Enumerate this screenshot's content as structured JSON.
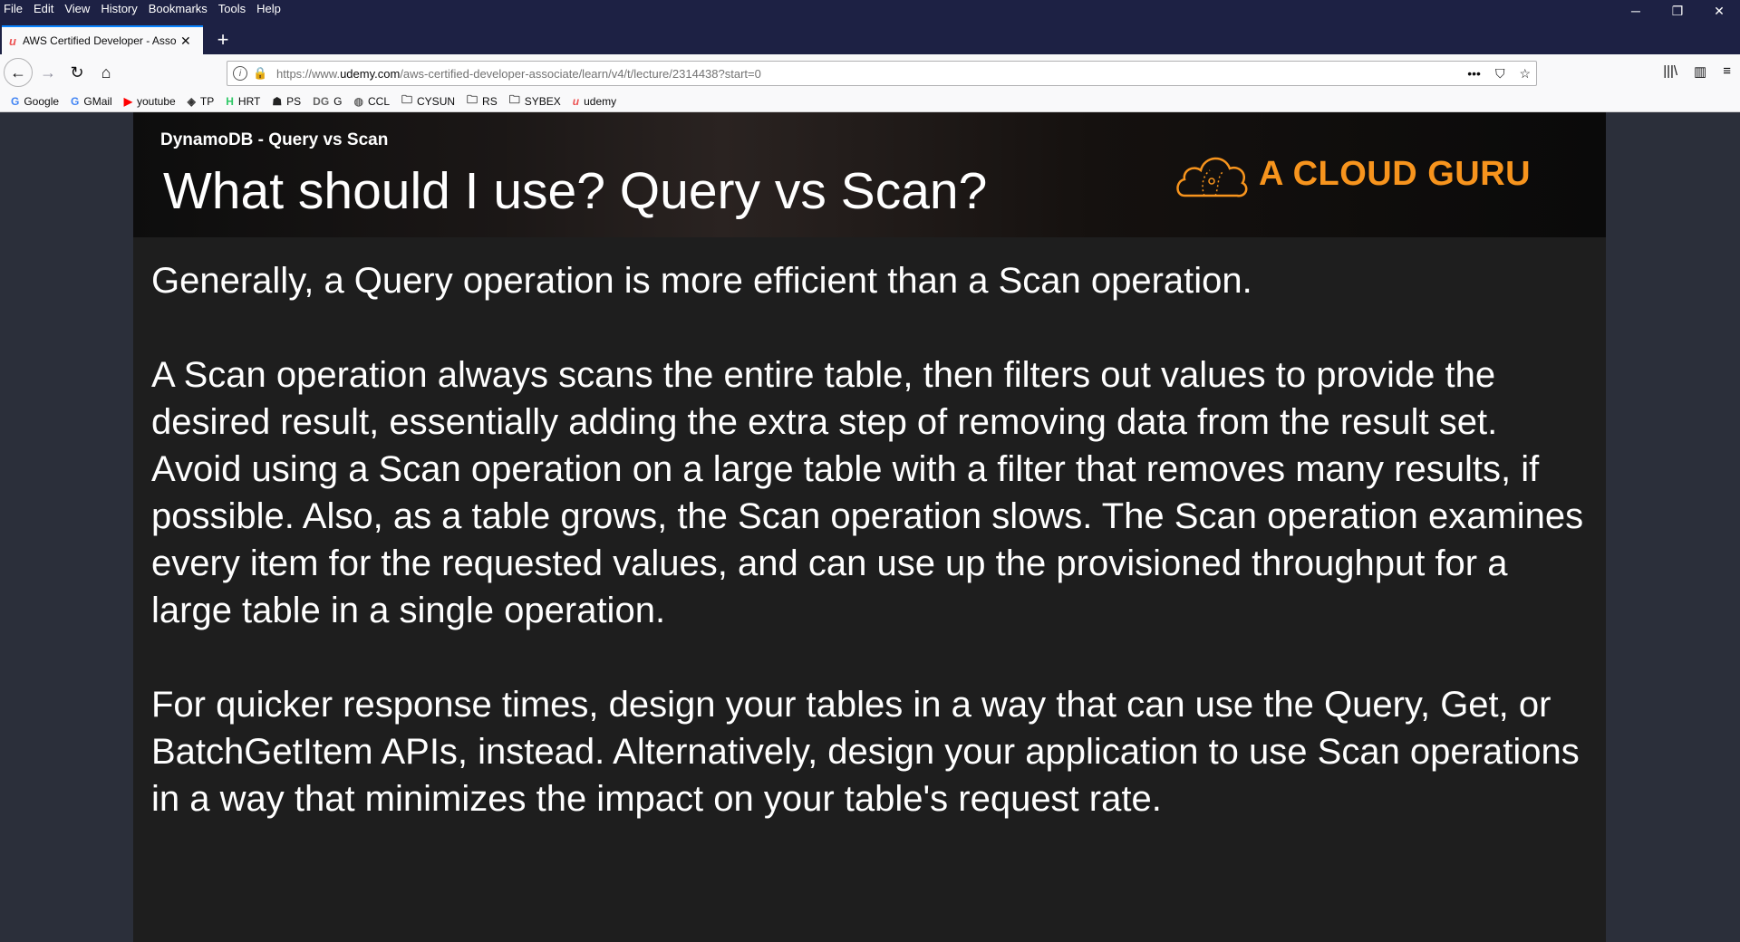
{
  "menu": {
    "items": [
      "File",
      "Edit",
      "View",
      "History",
      "Bookmarks",
      "Tools",
      "Help"
    ]
  },
  "window": {
    "minimize": "─",
    "restore": "❐",
    "close": "✕"
  },
  "tab": {
    "favicon": "u",
    "title": "AWS Certified Developer - Asso",
    "close": "✕",
    "new_tab": "+"
  },
  "nav": {
    "back": "←",
    "forward": "→",
    "reload": "↻",
    "home": "⌂",
    "url_prefix": "https://www.",
    "url_domain": "udemy.com",
    "url_path": "/aws-certified-developer-associate/learn/v4/t/lecture/2314438?start=0",
    "page_actions": "•••",
    "pocket": "⛉",
    "star": "☆",
    "library": "|||\\",
    "sidebar": "▥",
    "menu": "≡"
  },
  "bookmarks": [
    {
      "icon": "G",
      "label": "Google",
      "color": "#4285f4"
    },
    {
      "icon": "G",
      "label": "GMail",
      "color": "#4285f4"
    },
    {
      "icon": "▶",
      "label": "youtube",
      "color": "#ff0000"
    },
    {
      "icon": "◈",
      "label": "TP",
      "color": "#333333"
    },
    {
      "icon": "H",
      "label": "HRT",
      "color": "#2ec866"
    },
    {
      "icon": "☗",
      "label": "PS",
      "color": "#222222"
    },
    {
      "icon": "DG",
      "label": "G",
      "color": "#666666"
    },
    {
      "icon": "◍",
      "label": "CCL",
      "color": "#666666"
    },
    {
      "icon": "🗀",
      "label": "CYSUN",
      "color": "#333333"
    },
    {
      "icon": "🗀",
      "label": "RS",
      "color": "#333333"
    },
    {
      "icon": "🗀",
      "label": "SYBEX",
      "color": "#333333"
    },
    {
      "icon": "u",
      "label": "udemy",
      "color": "#ec5252"
    }
  ],
  "slide": {
    "lecture_label": "DynamoDB - Query vs Scan",
    "title": "What should I use? Query vs Scan?",
    "logo_text": "A CLOUD GURU",
    "logo_color": "#f7941d",
    "paragraphs": [
      "Generally, a Query operation is more efficient than a Scan operation.",
      "A Scan operation always scans the entire table, then filters out values to provide the desired result, essentially adding the extra step of removing data from the result set. Avoid using a Scan operation on a large table with a filter that removes many results, if possible. Also, as a table grows, the Scan operation slows. The Scan operation examines every item for the requested values, and can use up the provisioned throughput for a large table in a single operation.",
      "For quicker response times, design your tables in a way that can use the Query, Get, or BatchGetItem APIs, instead. Alternatively, design your application to use Scan operations in a way that minimizes the impact on your table's request rate."
    ]
  }
}
